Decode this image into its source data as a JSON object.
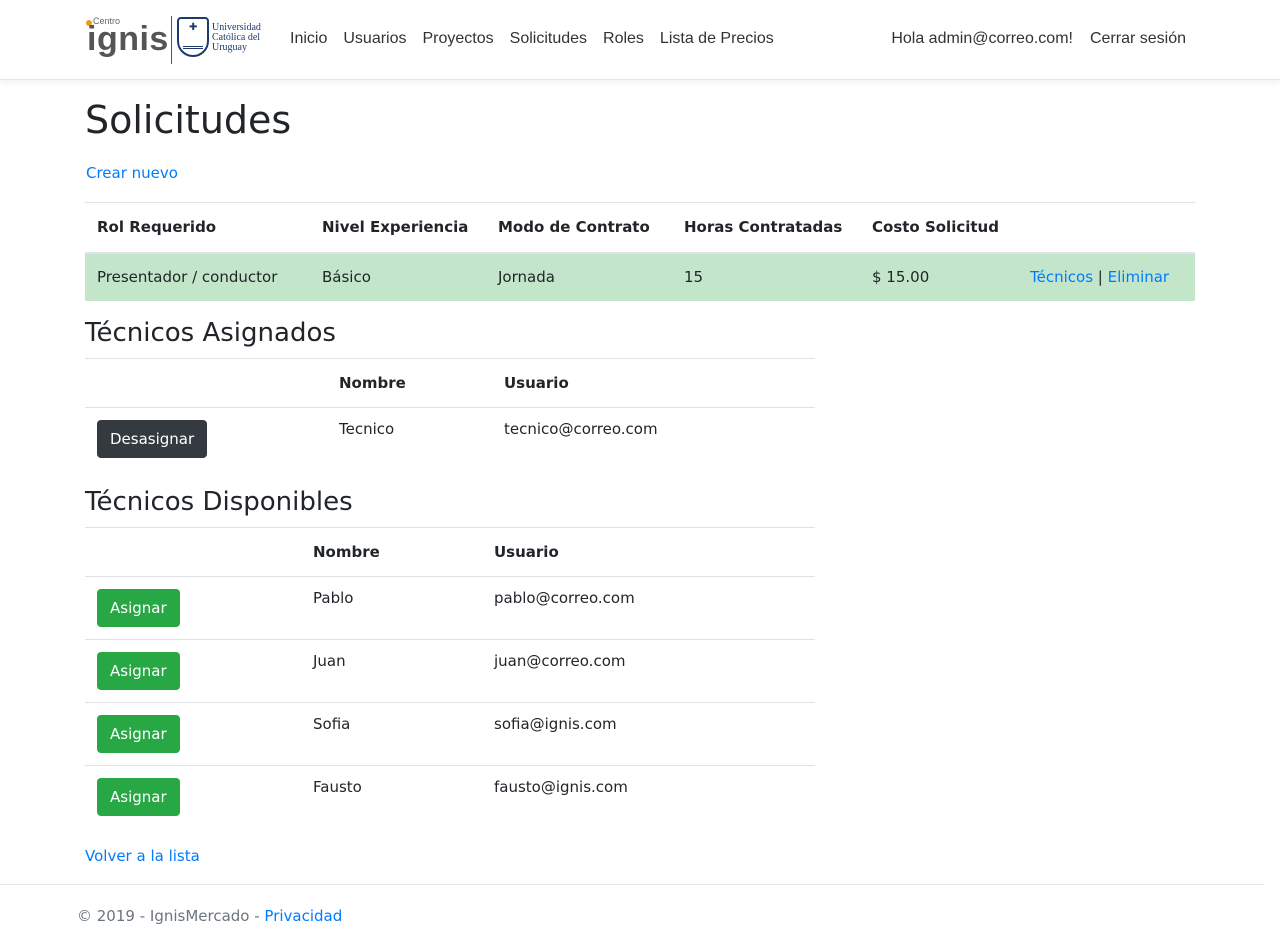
{
  "brand": {
    "centro": "Centro",
    "name": "ignis",
    "university": [
      "Universidad",
      "Católica del",
      "Uruguay"
    ]
  },
  "nav": {
    "links": [
      "Inicio",
      "Usuarios",
      "Proyectos",
      "Solicitudes",
      "Roles",
      "Lista de Precios"
    ],
    "greeting": "Hola admin@correo.com!",
    "logout": "Cerrar sesión"
  },
  "page": {
    "title": "Solicitudes",
    "create_link": "Crear nuevo"
  },
  "solicitud_table": {
    "headers": [
      "Rol Requerido",
      "Nivel Experiencia",
      "Modo de Contrato",
      "Horas Contratadas",
      "Costo Solicitud",
      ""
    ],
    "row": {
      "rol": "Presentador / conductor",
      "nivel": "Básico",
      "modo": "Jornada",
      "horas": "15",
      "costo": "$ 15.00",
      "tecnicos_link": "Técnicos",
      "separator": "|",
      "eliminar_link": "Eliminar"
    }
  },
  "asignados": {
    "title": "Técnicos Asignados",
    "headers": [
      "",
      "Nombre",
      "Usuario"
    ],
    "button_label": "Desasignar",
    "rows": [
      {
        "nombre": "Tecnico",
        "usuario": "tecnico@correo.com"
      }
    ]
  },
  "disponibles": {
    "title": "Técnicos Disponibles",
    "headers": [
      "",
      "Nombre",
      "Usuario"
    ],
    "button_label": "Asignar",
    "rows": [
      {
        "nombre": "Pablo",
        "usuario": "pablo@correo.com"
      },
      {
        "nombre": "Juan",
        "usuario": "juan@correo.com"
      },
      {
        "nombre": "Sofia",
        "usuario": "sofia@ignis.com"
      },
      {
        "nombre": "Fausto",
        "usuario": "fausto@ignis.com"
      }
    ]
  },
  "back_link": "Volver a la lista",
  "footer": {
    "copyright": "© 2019 - IgnisMercado - ",
    "privacy": "Privacidad"
  },
  "colors": {
    "link": "#007bff",
    "row_success": "#c3e6cb",
    "btn_dark": "#343a40",
    "btn_success": "#28a745"
  }
}
